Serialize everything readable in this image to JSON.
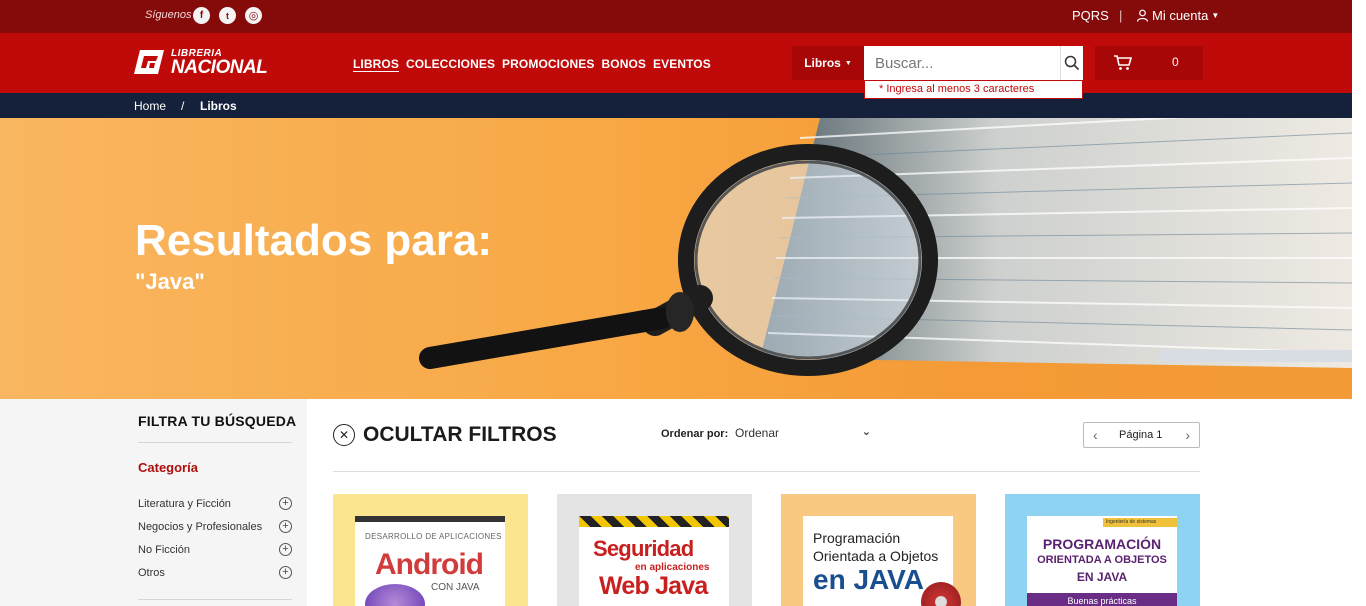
{
  "topbar": {
    "follow_label": "Síguenos",
    "social": [
      {
        "icon": "facebook-icon",
        "glyph": "f"
      },
      {
        "icon": "twitter-icon",
        "glyph": "t"
      },
      {
        "icon": "instagram-icon",
        "glyph": "◎"
      }
    ],
    "pqrs": "PQRS",
    "separator": "|",
    "account": "Mi cuenta"
  },
  "header": {
    "logo_small": "LIBRERIA",
    "logo_big": "NACIONAL",
    "nav": [
      "LIBROS",
      "COLECCIONES",
      "PROMOCIONES",
      "BONOS",
      "EVENTOS"
    ],
    "search_category": "Libros",
    "search_placeholder": "Buscar...",
    "search_hint": "* Ingresa al menos 3 caracteres",
    "cart_count": "0"
  },
  "breadcrumb": {
    "home": "Home",
    "separator": "/",
    "current": "Libros"
  },
  "hero": {
    "title": "Resultados para:",
    "query": "\"Java\""
  },
  "sidebar": {
    "title": "FILTRA TU BÚSQUEDA",
    "category_title": "Categoría",
    "categories": [
      "Literatura y Ficción",
      "Negocios y Profesionales",
      "No Ficción",
      "Otros"
    ]
  },
  "results": {
    "hide_filters": "OCULTAR FILTROS",
    "order_label": "Ordenar por:",
    "order_value": "Ordenar",
    "page_label": "Página 1"
  },
  "books": [
    {
      "bg": "#fbe68f",
      "cover_top": "DESARROLLO DE APLICACIONES",
      "cover_main": "Android",
      "cover_sub": "CON JAVA"
    },
    {
      "bg": "#e4e4e4",
      "cover_top": "Seguridad",
      "cover_main": "en aplicaciones",
      "cover_sub": "Web Java"
    },
    {
      "bg": "#f9c981",
      "cover_top": "Programación",
      "cover_main": "Orientada a Objetos",
      "cover_sub": "en JAVA"
    },
    {
      "bg": "#8fd3f2",
      "cover_top": "PROGRAMACIÓN",
      "cover_main": "ORIENTADA A OBJETOS",
      "cover_sub": "EN JAVA",
      "cover_extra": "Buenas prácticas",
      "cover_tag": "Ingeniería de sistemas"
    }
  ],
  "colors": {
    "topbar": "#850b0b",
    "header": "#c00909",
    "breadcrumb": "#15203a",
    "accent": "#b00d0d"
  }
}
